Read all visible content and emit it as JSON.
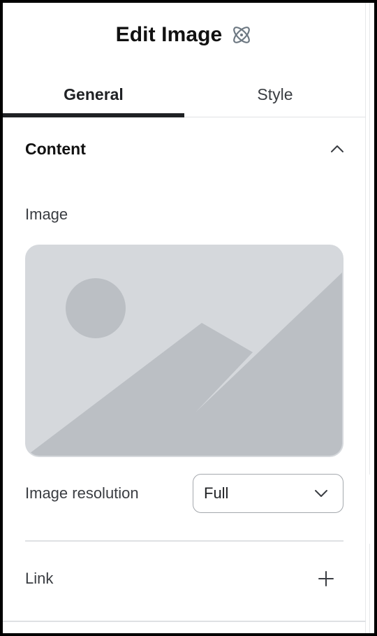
{
  "header": {
    "title": "Edit Image",
    "icon": "atom-icon"
  },
  "tabs": [
    {
      "label": "General",
      "active": true
    },
    {
      "label": "Style",
      "active": false
    }
  ],
  "section": {
    "title": "Content",
    "expanded": true,
    "toggle_icon": "chevron-up-icon"
  },
  "image_field": {
    "label": "Image",
    "placeholder_icon": "image-placeholder-icon"
  },
  "resolution": {
    "label": "Image resolution",
    "value": "Full",
    "icon": "chevron-down-icon"
  },
  "link": {
    "label": "Link",
    "icon": "plus-icon"
  },
  "colors": {
    "accent": "#1f2124",
    "placeholder_bg": "#d5d8dc",
    "placeholder_shape": "#bbbfc4",
    "border": "#dfe1e4"
  }
}
